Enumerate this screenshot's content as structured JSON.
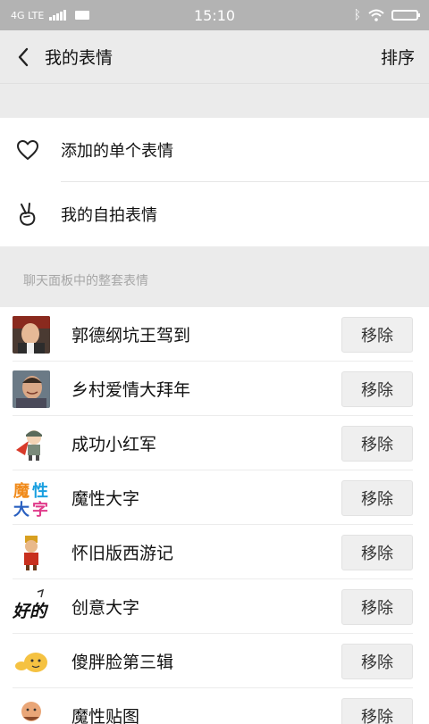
{
  "status_bar": {
    "network": "4G LTE",
    "time": "15:10"
  },
  "header": {
    "title": "我的表情",
    "sort_label": "排序"
  },
  "top_items": [
    {
      "label": "添加的单个表情",
      "icon": "heart-outline-icon"
    },
    {
      "label": "我的自拍表情",
      "icon": "peace-hand-icon"
    }
  ],
  "section_label": "聊天面板中的整套表情",
  "packs": [
    {
      "name": "郭德纲坑王驾到",
      "thumb": "photo-man-portrait",
      "button": "移除"
    },
    {
      "name": "乡村爱情大拜年",
      "thumb": "photo-man-smiling",
      "button": "移除"
    },
    {
      "name": "成功小红军",
      "thumb": "cartoon-red-soldier",
      "button": "移除"
    },
    {
      "name": "魔性大字",
      "thumb": "colorful-big-characters",
      "thumb_text": [
        "魔",
        "性",
        "大",
        "字"
      ],
      "button": "移除"
    },
    {
      "name": "怀旧版西游记",
      "thumb": "monkey-king-figure",
      "button": "移除"
    },
    {
      "name": "创意大字",
      "thumb": "handwritten-haode",
      "thumb_text": "好的",
      "button": "移除"
    },
    {
      "name": "傻胖脸第三辑",
      "thumb": "yellow-chubby-face",
      "button": "移除"
    },
    {
      "name": "魔性贴图",
      "thumb": "cartoon-bald-man",
      "button": "移除"
    }
  ],
  "colors": {
    "status_bar": "#b3b3b3",
    "background": "#ebebeb",
    "section_text": "#a6a6a6",
    "button_bg": "#efefef"
  }
}
